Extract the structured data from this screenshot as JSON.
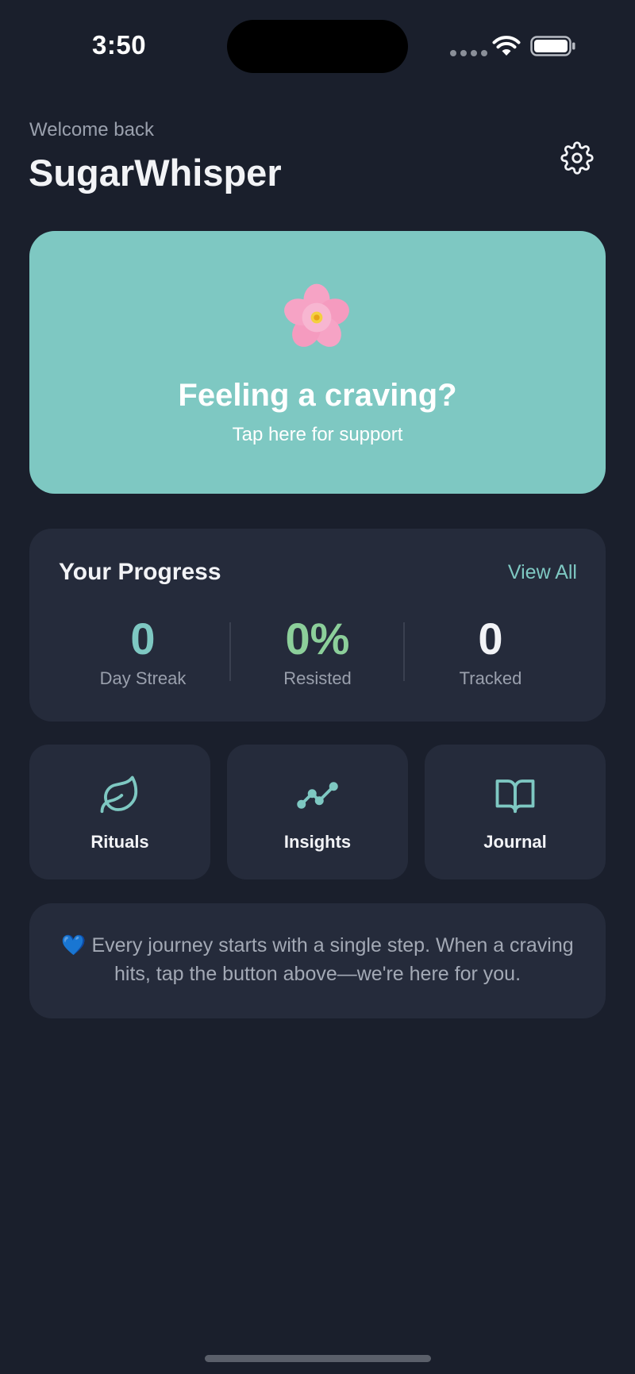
{
  "status_bar": {
    "time": "3:50"
  },
  "header": {
    "welcome": "Welcome back",
    "title": "SugarWhisper",
    "settings_icon": "gear-icon"
  },
  "craving_card": {
    "icon": "cherry-blossom",
    "title": "Feeling a craving?",
    "subtitle": "Tap here for support"
  },
  "progress": {
    "title": "Your Progress",
    "view_all": "View All",
    "stats": [
      {
        "value": "0",
        "label": "Day Streak",
        "color": "#7ec8c2"
      },
      {
        "value": "0%",
        "label": "Resisted",
        "color": "#8ccf9a"
      },
      {
        "value": "0",
        "label": "Tracked",
        "color": "#f2f3f6"
      }
    ]
  },
  "tiles": [
    {
      "label": "Rituals",
      "icon": "leaf-icon"
    },
    {
      "label": "Insights",
      "icon": "trend-line-icon"
    },
    {
      "label": "Journal",
      "icon": "open-book-icon"
    }
  ],
  "message": {
    "emoji": "💙",
    "text": "Every journey starts with a single step. When a craving hits, tap the button above—we're here for you."
  },
  "colors": {
    "background": "#1a1f2c",
    "card": "#252b3b",
    "accent": "#7ec8c2",
    "success": "#8ccf9a"
  }
}
